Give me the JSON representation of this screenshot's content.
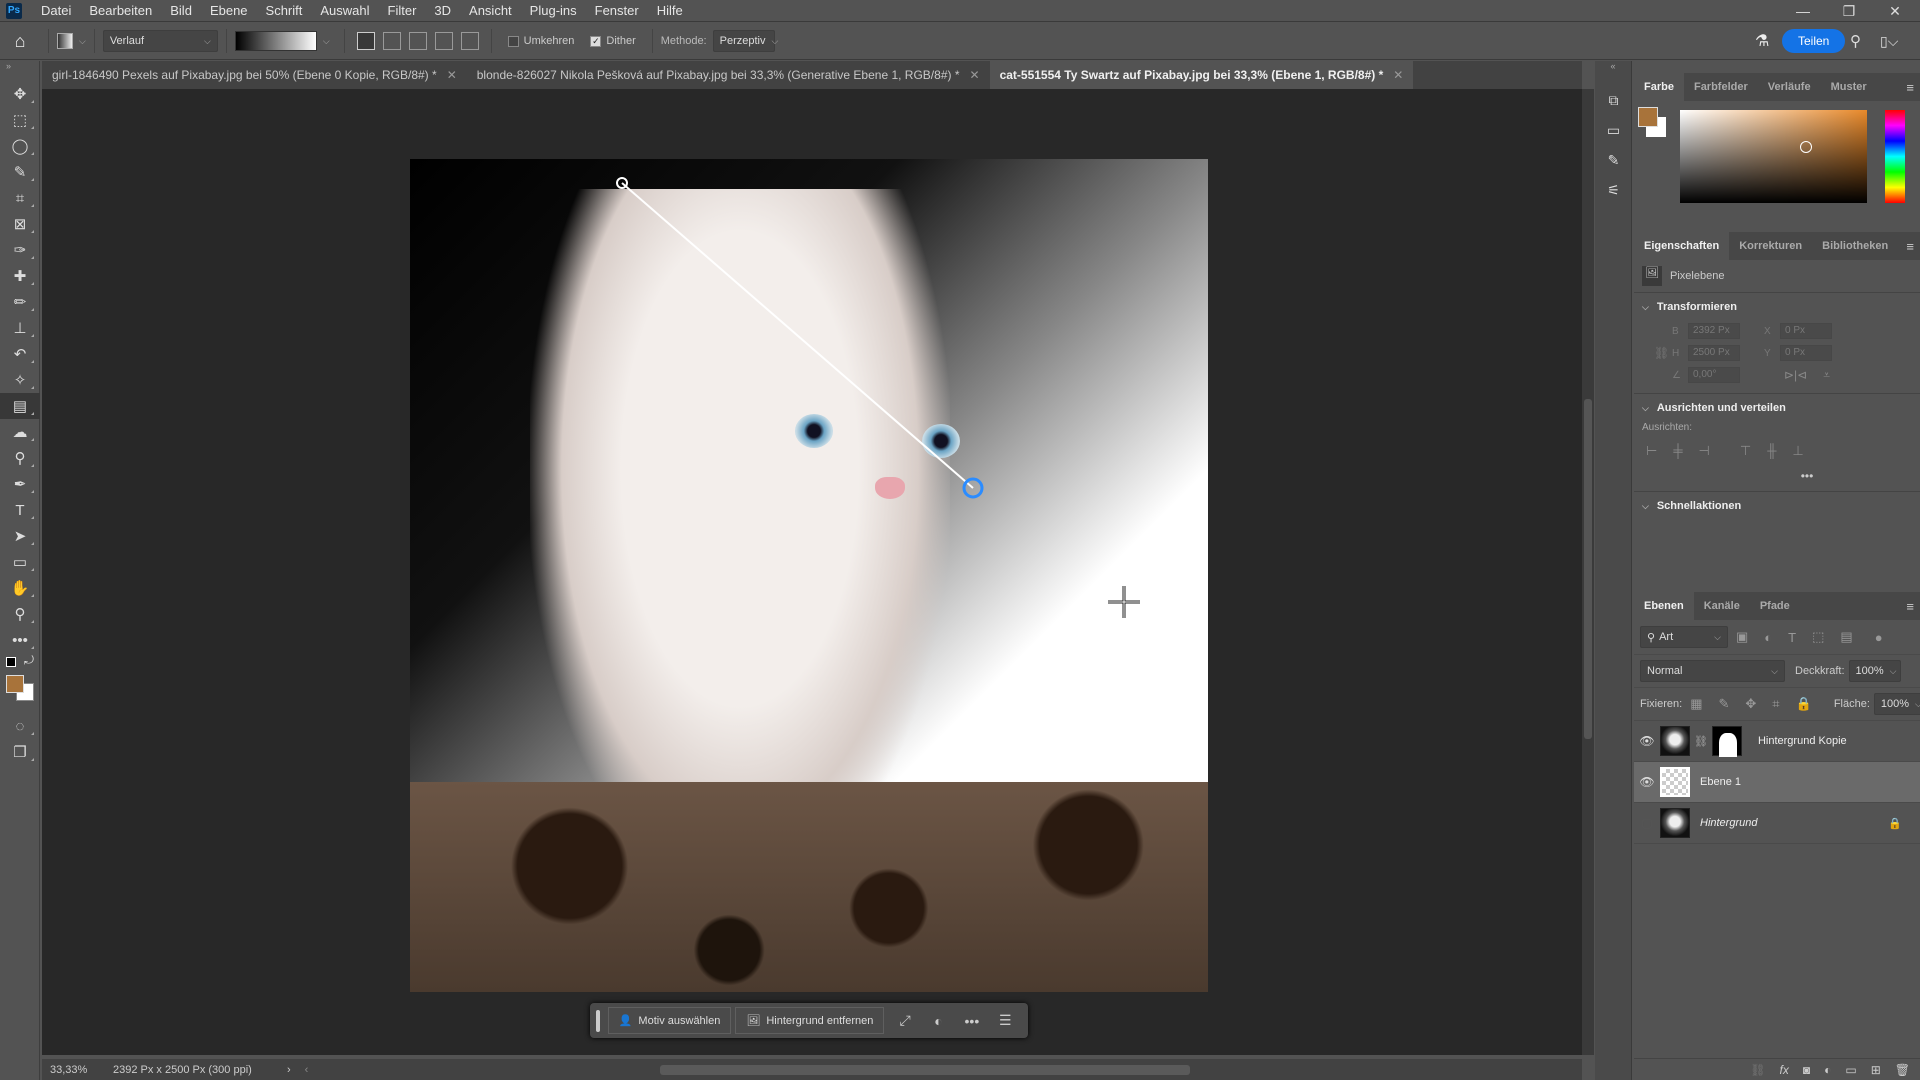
{
  "app": {
    "logo": "Ps",
    "menu": [
      "Datei",
      "Bearbeiten",
      "Bild",
      "Ebene",
      "Schrift",
      "Auswahl",
      "Filter",
      "3D",
      "Ansicht",
      "Plug-ins",
      "Fenster",
      "Hilfe"
    ],
    "window_controls": {
      "minimize": "—",
      "restore": "❐",
      "close": "✕"
    }
  },
  "options": {
    "tool_preset": "Verlauf",
    "umkehren_label": "Umkehren",
    "umkehren_checked": false,
    "dither_label": "Dither",
    "dither_checked": true,
    "methode_label": "Methode:",
    "methode_value": "Perzeptiv",
    "share_label": "Teilen"
  },
  "tabs": [
    {
      "label": "girl-1846490 Pexels auf Pixabay.jpg bei 50% (Ebene 0 Kopie, RGB/8#) *",
      "active": false
    },
    {
      "label": "blonde-826027 Nikola Pešková auf Pixabay.jpg bei 33,3% (Generative Ebene 1, RGB/8#) *",
      "active": false
    },
    {
      "label": "cat-551554 Ty Swartz auf Pixabay.jpg bei 33,3% (Ebene 1, RGB/8#) *",
      "active": true
    }
  ],
  "tools": [
    {
      "name": "move-tool",
      "glyph": "✥"
    },
    {
      "name": "marquee-tool",
      "glyph": "⬚"
    },
    {
      "name": "lasso-tool",
      "glyph": "◯"
    },
    {
      "name": "quick-selection-tool",
      "glyph": "✎"
    },
    {
      "name": "crop-tool",
      "glyph": "⌗"
    },
    {
      "name": "frame-tool",
      "glyph": "⊠"
    },
    {
      "name": "eyedropper-tool",
      "glyph": "✑"
    },
    {
      "name": "healing-brush-tool",
      "glyph": "✚"
    },
    {
      "name": "brush-tool",
      "glyph": "✏"
    },
    {
      "name": "stamp-tool",
      "glyph": "⊥"
    },
    {
      "name": "history-brush-tool",
      "glyph": "↶"
    },
    {
      "name": "eraser-tool",
      "glyph": "✧"
    },
    {
      "name": "gradient-tool",
      "glyph": "▤",
      "active": true
    },
    {
      "name": "blur-tool",
      "glyph": "☁"
    },
    {
      "name": "dodge-tool",
      "glyph": "⚲"
    },
    {
      "name": "pen-tool",
      "glyph": "✒"
    },
    {
      "name": "type-tool",
      "glyph": "T"
    },
    {
      "name": "path-selection-tool",
      "glyph": "➤"
    },
    {
      "name": "rectangle-tool",
      "glyph": "▭"
    },
    {
      "name": "hand-tool",
      "glyph": "✋"
    },
    {
      "name": "zoom-tool",
      "glyph": "⚲"
    },
    {
      "name": "more-tools",
      "glyph": "•••"
    }
  ],
  "colors": {
    "foreground": "#a8733a",
    "background": "#ffffff",
    "accent": "#1473e6"
  },
  "taskbar": {
    "select_subject": "Motiv auswählen",
    "remove_bg": "Hintergrund entfernen"
  },
  "status": {
    "zoom": "33,33%",
    "doc_info": "2392 Px x 2500 Px (300 ppi)"
  },
  "color_panel": {
    "tabs": [
      "Farbe",
      "Farbfelder",
      "Verläufe",
      "Muster"
    ]
  },
  "properties": {
    "tabs": [
      "Eigenschaften",
      "Korrekturen",
      "Bibliotheken"
    ],
    "layer_type": "Pixelebene",
    "transform_title": "Transformieren",
    "w_label": "B",
    "w_value": "2392 Px",
    "h_label": "H",
    "h_value": "2500 Px",
    "x_label": "X",
    "x_value": "0 Px",
    "y_label": "Y",
    "y_value": "0 Px",
    "angle_value": "0,00°",
    "align_title": "Ausrichten und verteilen",
    "align_label": "Ausrichten:",
    "quick_title": "Schnellaktionen"
  },
  "layers": {
    "tabs": [
      "Ebenen",
      "Kanäle",
      "Pfade"
    ],
    "filter": "Art",
    "blend_mode": "Normal",
    "opacity_label": "Deckkraft:",
    "opacity": "100%",
    "lock_label": "Fixieren:",
    "fill_label": "Fläche:",
    "fill": "100%",
    "items": [
      {
        "name": "Hintergrund Kopie",
        "visible": true,
        "mask": true
      },
      {
        "name": "Ebene 1",
        "visible": true,
        "selected": true
      },
      {
        "name": "Hintergrund",
        "visible": false,
        "locked": true,
        "italic": true
      }
    ]
  }
}
